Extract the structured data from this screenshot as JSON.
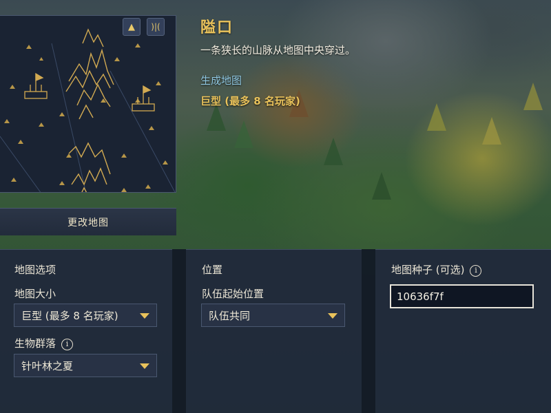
{
  "map": {
    "title": "隘口",
    "description": "一条狭长的山脉从地图中央穿过。",
    "generate_link": "生成地图",
    "size_summary": "巨型 (最多 8 名玩家)",
    "change_button": "更改地图",
    "tools": [
      {
        "icon": "mountain-icon"
      },
      {
        "icon": "mirror-icon"
      }
    ]
  },
  "map_options": {
    "heading": "地图选项",
    "size_label": "地图大小",
    "size_value": "巨型 (最多 8 名玩家)",
    "biome_label": "生物群落",
    "biome_value": "针叶林之夏"
  },
  "position": {
    "heading": "位置",
    "team_start_label": "队伍起始位置",
    "team_start_value": "队伍共同"
  },
  "seed": {
    "heading": "地图种子 (可选)",
    "value": "10636f7f"
  },
  "colors": {
    "accent_gold": "#e9c25b",
    "link_blue": "#8fc6e0",
    "panel_bg": "#202a3a"
  }
}
